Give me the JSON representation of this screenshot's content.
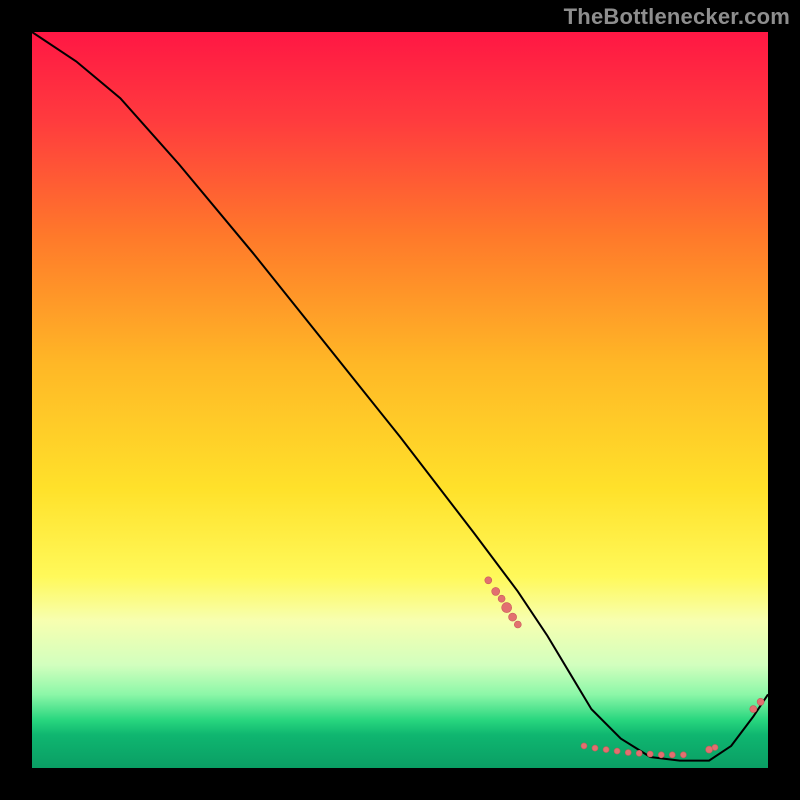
{
  "attribution": "TheBottlenecker.com",
  "colors": {
    "bg": "#000000",
    "attribution_text": "#8e8e8e",
    "curve": "#000000",
    "marker_fill": "#e27070",
    "marker_stroke": "#c85a5a",
    "gradient_stops": [
      {
        "offset": 0.0,
        "color": "#ff1744"
      },
      {
        "offset": 0.12,
        "color": "#ff3b3e"
      },
      {
        "offset": 0.28,
        "color": "#ff7a2a"
      },
      {
        "offset": 0.45,
        "color": "#ffb726"
      },
      {
        "offset": 0.62,
        "color": "#ffe12a"
      },
      {
        "offset": 0.74,
        "color": "#fff95a"
      },
      {
        "offset": 0.8,
        "color": "#f7ffb0"
      },
      {
        "offset": 0.86,
        "color": "#d2ffbe"
      },
      {
        "offset": 0.9,
        "color": "#8cf7a8"
      },
      {
        "offset": 0.935,
        "color": "#28d67e"
      },
      {
        "offset": 0.955,
        "color": "#0fb670"
      },
      {
        "offset": 1.0,
        "color": "#0a9e64"
      }
    ]
  },
  "chart_data": {
    "type": "line",
    "title": "",
    "xlabel": "",
    "ylabel": "",
    "xlim": [
      0,
      100
    ],
    "ylim": [
      0,
      100
    ],
    "grid": false,
    "legend": false,
    "x": [
      0,
      6,
      12,
      20,
      30,
      40,
      50,
      60,
      66,
      70,
      73,
      76,
      80,
      84,
      88,
      92,
      95,
      98,
      100
    ],
    "values": [
      100,
      96,
      91,
      82,
      70,
      57.5,
      45,
      32,
      24,
      18,
      13,
      8,
      4,
      1.5,
      1,
      1,
      3,
      7,
      10
    ],
    "markers": [
      {
        "x": 62.0,
        "y": 25.5,
        "r": 3.5
      },
      {
        "x": 63.0,
        "y": 24.0,
        "r": 4.0
      },
      {
        "x": 63.8,
        "y": 23.0,
        "r": 3.5
      },
      {
        "x": 64.5,
        "y": 21.8,
        "r": 5.0
      },
      {
        "x": 65.3,
        "y": 20.5,
        "r": 4.0
      },
      {
        "x": 66.0,
        "y": 19.5,
        "r": 3.5
      },
      {
        "x": 75.0,
        "y": 3.0,
        "r": 3.0
      },
      {
        "x": 76.5,
        "y": 2.7,
        "r": 3.0
      },
      {
        "x": 78.0,
        "y": 2.5,
        "r": 3.0
      },
      {
        "x": 79.5,
        "y": 2.3,
        "r": 3.0
      },
      {
        "x": 81.0,
        "y": 2.1,
        "r": 3.0
      },
      {
        "x": 82.5,
        "y": 2.0,
        "r": 3.0
      },
      {
        "x": 84.0,
        "y": 1.9,
        "r": 3.0
      },
      {
        "x": 85.5,
        "y": 1.8,
        "r": 3.0
      },
      {
        "x": 87.0,
        "y": 1.8,
        "r": 3.0
      },
      {
        "x": 88.5,
        "y": 1.8,
        "r": 3.0
      },
      {
        "x": 92.0,
        "y": 2.5,
        "r": 3.5
      },
      {
        "x": 92.8,
        "y": 2.8,
        "r": 3.0
      },
      {
        "x": 98.0,
        "y": 8.0,
        "r": 3.5
      },
      {
        "x": 99.0,
        "y": 9.0,
        "r": 3.5
      }
    ]
  }
}
